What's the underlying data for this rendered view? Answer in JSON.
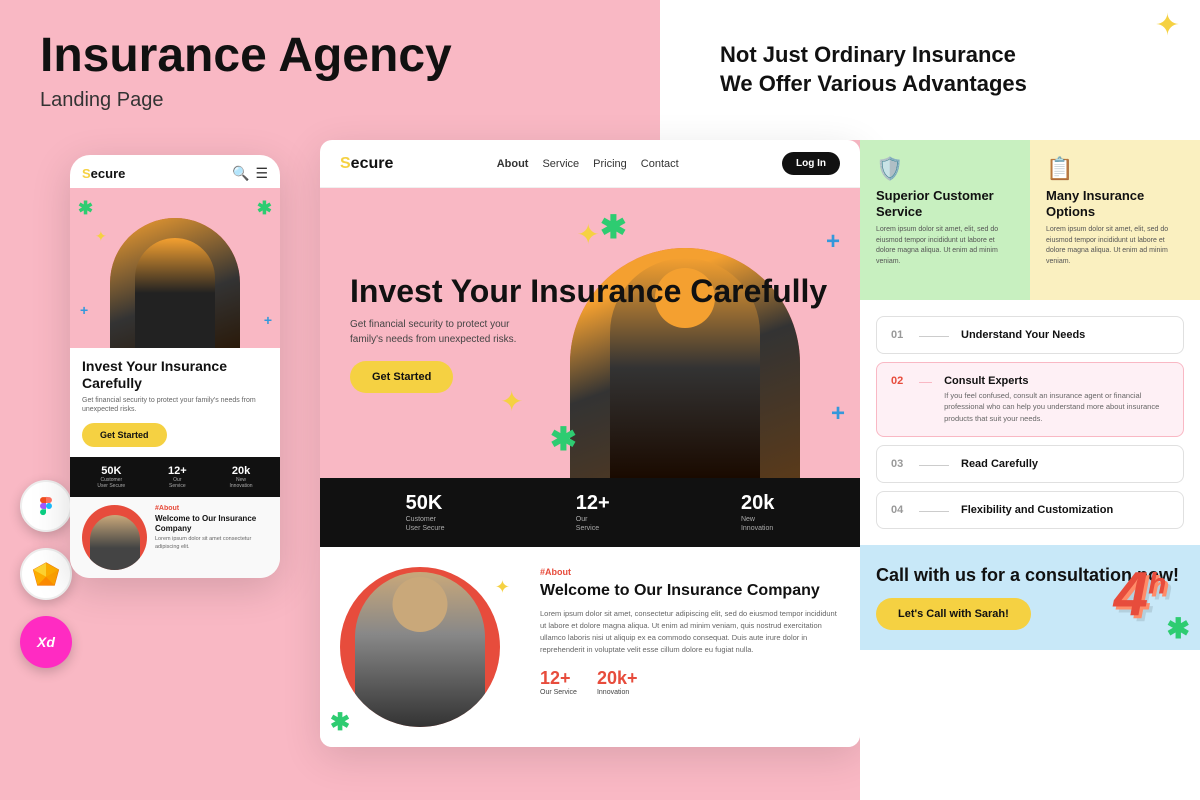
{
  "page": {
    "title": "Insurance Agency",
    "subtitle": "Landing Page",
    "background_color": "#f9b8c4"
  },
  "top_right": {
    "line1": "Not Just Ordinary Insurance",
    "line2": "We Offer Various Advantages"
  },
  "mobile_mockup": {
    "logo": "Secure",
    "hero_title": "Invest Your Insurance Carefully",
    "hero_subtitle": "Get financial security to protect your family's needs from unexpected risks.",
    "cta_button": "Get Started",
    "stats": [
      {
        "num": "50K",
        "label": "Customer\nUser Secure"
      },
      {
        "num": "12+",
        "label": "Our\nService"
      },
      {
        "num": "20k",
        "label": "New\nInnovation"
      }
    ],
    "about_tag": "#About",
    "about_title": "Welcome to Our Insurance Company",
    "about_text": "Lorem ipsum dolor sit amet consectetur adipiscing elit."
  },
  "desktop_mockup": {
    "logo": "Secure",
    "nav_links": [
      "About",
      "Service",
      "Pricing",
      "Contact"
    ],
    "nav_active": "About",
    "login_button": "Log In",
    "hero_title": "Invest Your Insurance Carefully",
    "hero_subtitle": "Get financial security to protect your family's needs from unexpected risks.",
    "cta_button": "Get Started",
    "stats": [
      {
        "num": "50K",
        "label": "Customer\nUser Secure"
      },
      {
        "num": "12+",
        "label": "Our\nService"
      },
      {
        "num": "20k",
        "label": "New\nInnovation"
      }
    ],
    "about_tag": "#About",
    "about_title": "Welcome to Our Insurance Company",
    "about_text": "Lorem ipsum dolor sit amet, consectetur adipiscing elit, sed do eiusmod tempor incididunt ut labore et dolore magna aliqua. Ut enim ad minim veniam, quis nostrud exercitation ullamco laboris nisi ut aliquip ex ea commodo consequat. Duis aute irure dolor in reprehenderit in voluptate velit esse cillum dolore eu fugiat nulla.",
    "stat2": [
      {
        "num": "12+",
        "label": "Our Service"
      },
      {
        "num": "20k+",
        "label": "Innovation"
      }
    ]
  },
  "right_panel": {
    "cards": [
      {
        "id": "superior",
        "icon": "🛡️",
        "title": "Superior Customer Service",
        "text": "Lorem ipsum dolor sit amet, elit, sed do eiusmod tempor incididunt ut labore et dolore magna aliqua. Ut enim ad minim veniam.",
        "bg": "green"
      },
      {
        "id": "many-options",
        "icon": "📋",
        "title": "Many Insurance Options",
        "text": "Lorem ipsum dolor sit amet, elit, sed do eiusmod tempor incididunt ut labore et dolore magna aliqua. Ut enim ad minim veniam.",
        "bg": "yellow"
      }
    ],
    "steps": [
      {
        "num": "01",
        "title": "Understand Your Needs",
        "text": "",
        "active": false
      },
      {
        "num": "02",
        "title": "Consult Experts",
        "text": "If you feel confused, consult an insurance agent or financial professional who can help you understand more about insurance products that suit your needs.",
        "active": true
      },
      {
        "num": "03",
        "title": "Read Carefully",
        "text": "",
        "active": false
      },
      {
        "num": "04",
        "title": "Flexibility and Customization",
        "text": "",
        "active": false
      }
    ],
    "cta": {
      "title": "Call with us for a consultation now!",
      "button": "Let's Call with Sarah!"
    }
  },
  "design_tools": [
    {
      "name": "Figma",
      "symbol": "F",
      "color": "#fff"
    },
    {
      "name": "Sketch",
      "symbol": "S",
      "color": "#fff"
    },
    {
      "name": "Adobe XD",
      "symbol": "Xd",
      "color": "#ff2bc2"
    }
  ]
}
